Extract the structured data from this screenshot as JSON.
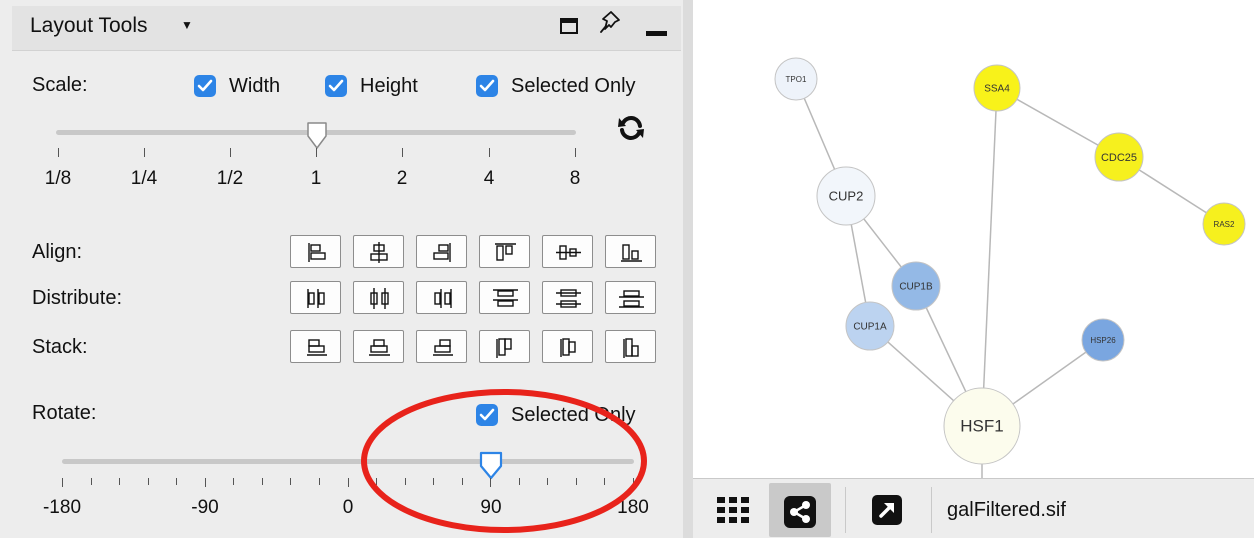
{
  "panel": {
    "title": "Layout Tools",
    "scale": {
      "label": "Scale:",
      "width_label": "Width",
      "height_label": "Height",
      "selected_only_label": "Selected Only",
      "width_checked": true,
      "height_checked": true,
      "selected_only_checked": true,
      "tick_labels": [
        "1/8",
        "1/4",
        "1/2",
        "1",
        "2",
        "4",
        "8"
      ],
      "current_value": "1"
    },
    "align_label": "Align:",
    "distribute_label": "Distribute:",
    "stack_label": "Stack:",
    "rotate": {
      "label": "Rotate:",
      "selected_only_label": "Selected Only",
      "selected_only_checked": true,
      "tick_labels": [
        "-180",
        "-90",
        "0",
        "90",
        "180"
      ],
      "current_value": 90
    }
  },
  "network": {
    "nodes": [
      {
        "id": "TPO1",
        "label": "TPO1",
        "color": "#eef3fa"
      },
      {
        "id": "SSA4",
        "label": "SSA4",
        "color": "#f8f21a"
      },
      {
        "id": "CDC25",
        "label": "CDC25",
        "color": "#f6f01e"
      },
      {
        "id": "RAS2",
        "label": "RAS2",
        "color": "#f6f01e"
      },
      {
        "id": "CUP2",
        "label": "CUP2",
        "color": "#f2f6fb"
      },
      {
        "id": "CUP1B",
        "label": "CUP1B",
        "color": "#94b9e6"
      },
      {
        "id": "CUP1A",
        "label": "CUP1A",
        "color": "#bcd3f0"
      },
      {
        "id": "HSP26",
        "label": "HSP26",
        "color": "#7aa6e0"
      },
      {
        "id": "HSF1",
        "label": "HSF1",
        "color": "#fcfced"
      }
    ]
  },
  "toolbar": {
    "file_name": "galFiltered.sif"
  },
  "colors": {
    "accent": "#2d84e6",
    "annotation_circle": "#e8231b"
  },
  "icons": [
    "chevron-down-icon",
    "window-icon",
    "pin-icon",
    "minimize-icon",
    "refresh-icon",
    "grid-icon",
    "share-icon",
    "arrow-icon"
  ]
}
